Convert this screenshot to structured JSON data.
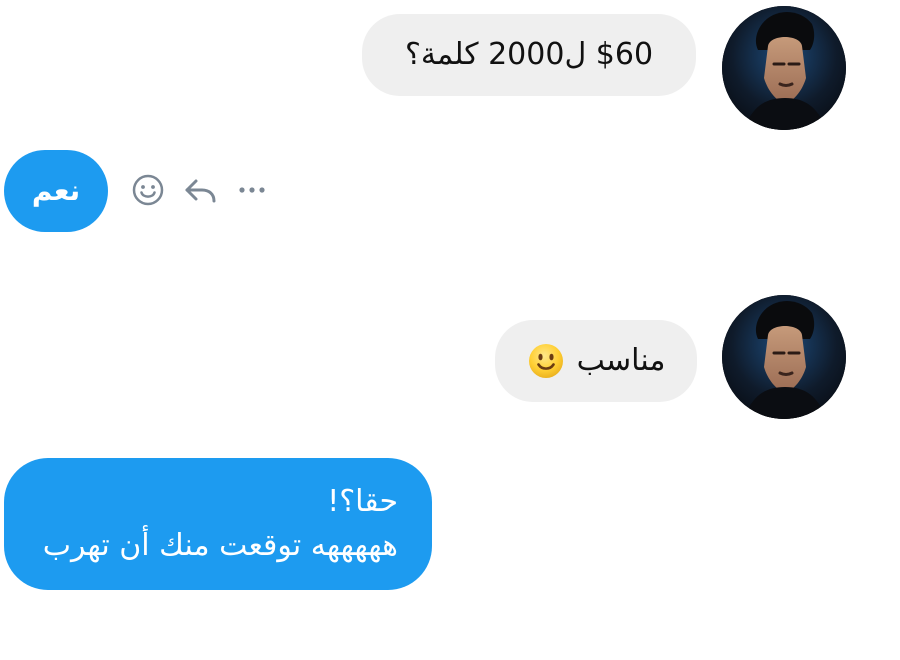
{
  "messages": [
    {
      "id": "m1",
      "text": "$60 ل2000 كلمة؟"
    },
    {
      "id": "m2",
      "text": "نعم"
    },
    {
      "id": "m3",
      "text": "مناسب"
    },
    {
      "id": "m4",
      "lines": [
        "حقا؟!",
        "هههههه توقعت منك أن تهرب"
      ]
    }
  ],
  "icons": {
    "avatar": "avatar",
    "emoji": "emoji-react-icon",
    "reply": "reply-icon",
    "more": "more-icon",
    "smile": "smile-emoji-icon"
  },
  "colors": {
    "incoming_bubble": "#efefef",
    "outgoing_bubble": "#1d9bf0",
    "text_dark": "#111111",
    "text_light": "#ffffff",
    "icon_gray": "#7b8794"
  }
}
